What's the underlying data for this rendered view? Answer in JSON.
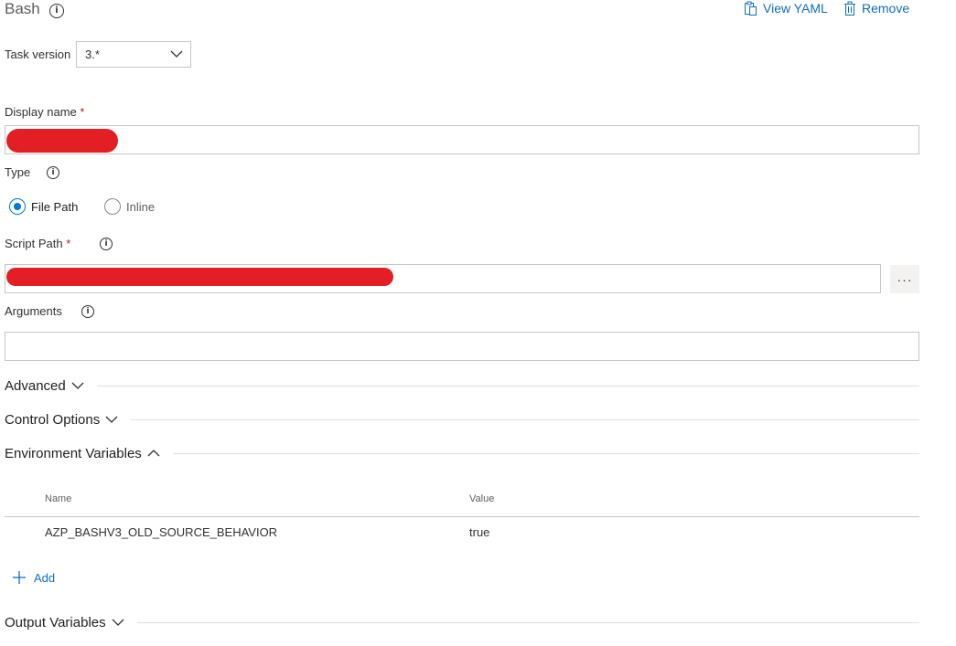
{
  "header": {
    "title": "Bash",
    "view_yaml": "View YAML",
    "remove": "Remove"
  },
  "task_version": {
    "label": "Task version",
    "value": "3.*"
  },
  "display_name": {
    "label": "Display name",
    "required_mark": "*"
  },
  "type": {
    "label": "Type",
    "options": [
      {
        "label": "File Path",
        "selected": true
      },
      {
        "label": "Inline",
        "selected": false
      }
    ]
  },
  "script_path": {
    "label": "Script Path",
    "required_mark": "*",
    "browse_label": "···"
  },
  "arguments": {
    "label": "Arguments",
    "value": ""
  },
  "sections": {
    "advanced": "Advanced",
    "control_options": "Control Options",
    "environment_variables": "Environment Variables",
    "output_variables": "Output Variables"
  },
  "env_table": {
    "columns": [
      "Name",
      "Value"
    ],
    "rows": [
      {
        "name": "AZP_BASHV3_OLD_SOURCE_BEHAVIOR",
        "value": "true"
      }
    ],
    "add_label": "Add"
  },
  "colors": {
    "accent": "#0078d4",
    "link": "#106ebe",
    "required": "#a4262c",
    "redaction": "#e31e24"
  }
}
